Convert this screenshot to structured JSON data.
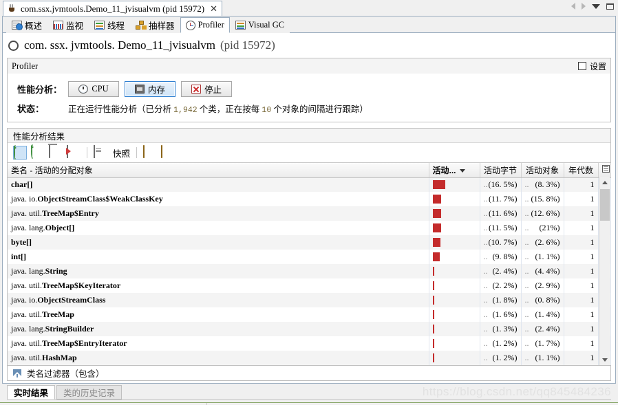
{
  "window": {
    "tab_title": "com.ssx.jvmtools.Demo_11_jvisualvm (pid 15972)",
    "close_label": "✕",
    "icon": "java-coffee-icon"
  },
  "view_tabs": [
    {
      "label": "概述",
      "icon": "overview-icon",
      "active": false
    },
    {
      "label": "监视",
      "icon": "monitor-icon",
      "active": false
    },
    {
      "label": "线程",
      "icon": "threads-icon",
      "active": false
    },
    {
      "label": "抽样器",
      "icon": "sampler-icon",
      "active": false
    },
    {
      "label": "Profiler",
      "icon": "profiler-icon",
      "active": true
    },
    {
      "label": "Visual GC",
      "icon": "visual-gc-icon",
      "active": false
    }
  ],
  "app_header": {
    "name": "com. ssx. jvmtools. Demo_11_jvisualvm",
    "pid": "(pid 15972)"
  },
  "subbar": {
    "title": "Profiler",
    "settings_label": "设置",
    "settings_checked": false
  },
  "profiling": {
    "row_label": "性能分析：",
    "buttons": [
      {
        "label": "CPU",
        "icon": "cpu-icon",
        "selected": false
      },
      {
        "label": "内存",
        "icon": "memory-icon",
        "selected": true
      },
      {
        "label": "停止",
        "icon": "stop-icon",
        "selected": false
      }
    ],
    "status_label": "状态：",
    "status_prefix": "正在运行性能分析（已分析 ",
    "status_classes": "1,942",
    "status_middle": " 个类，正在按每 ",
    "status_interval": "10",
    "status_suffix": " 个对象的间隔进行跟踪）"
  },
  "results": {
    "header": "性能分析结果",
    "toolbar": [
      {
        "name": "refresh-results-icon",
        "label": ""
      },
      {
        "name": "auto-refresh-icon",
        "label": ""
      },
      {
        "name": "reset-collected-results-icon",
        "label": ""
      },
      {
        "name": "export-icon",
        "label": ""
      },
      {
        "name": "snapshot-icon",
        "label": "快照"
      },
      {
        "name": "load-snapshot-icon",
        "label": ""
      },
      {
        "name": "save-snapshot-icon",
        "label": ""
      }
    ],
    "columns": [
      "类名 - 活动的分配对象",
      "活动...",
      "活动字节",
      "活动对象",
      "年代数"
    ],
    "sorted_column_index": 1,
    "rows": [
      {
        "pkg": "",
        "cls": "char[]",
        "bar_pct": 16.5,
        "bytes_pct": "(16. 5%)",
        "objects_pct": "(8. 3%)",
        "generations": "1"
      },
      {
        "pkg": "java. io.",
        "cls": "ObjectStreamClass$WeakClassKey",
        "bar_pct": 11.7,
        "bytes_pct": "(11. 7%)",
        "objects_pct": "(15. 8%)",
        "generations": "1"
      },
      {
        "pkg": "java. util.",
        "cls": "TreeMap$Entry",
        "bar_pct": 11.6,
        "bytes_pct": "(11. 6%)",
        "objects_pct": "(12. 6%)",
        "generations": "1"
      },
      {
        "pkg": "java. lang.",
        "cls": "Object[]",
        "bar_pct": 11.5,
        "bytes_pct": "(11. 5%)",
        "objects_pct": "(21%)",
        "generations": "1"
      },
      {
        "pkg": "",
        "cls": "byte[]",
        "bar_pct": 10.7,
        "bytes_pct": "(10. 7%)",
        "objects_pct": "(2. 6%)",
        "generations": "1"
      },
      {
        "pkg": "",
        "cls": "int[]",
        "bar_pct": 9.8,
        "bytes_pct": "(9. 8%)",
        "objects_pct": "(1. 1%)",
        "generations": "1"
      },
      {
        "pkg": "java. lang.",
        "cls": "String",
        "bar_pct": 2.4,
        "bytes_pct": "(2. 4%)",
        "objects_pct": "(4. 4%)",
        "generations": "1"
      },
      {
        "pkg": "java. util.",
        "cls": "TreeMap$KeyIterator",
        "bar_pct": 2.2,
        "bytes_pct": "(2. 2%)",
        "objects_pct": "(2. 9%)",
        "generations": "1"
      },
      {
        "pkg": "java. io.",
        "cls": "ObjectStreamClass",
        "bar_pct": 1.8,
        "bytes_pct": "(1. 8%)",
        "objects_pct": "(0. 8%)",
        "generations": "1"
      },
      {
        "pkg": "java. util.",
        "cls": "TreeMap",
        "bar_pct": 1.6,
        "bytes_pct": "(1. 6%)",
        "objects_pct": "(1. 4%)",
        "generations": "1"
      },
      {
        "pkg": "java. lang.",
        "cls": "StringBuilder",
        "bar_pct": 1.3,
        "bytes_pct": "(1. 3%)",
        "objects_pct": "(2. 4%)",
        "generations": "1"
      },
      {
        "pkg": "java. util.",
        "cls": "TreeMap$EntryIterator",
        "bar_pct": 1.2,
        "bytes_pct": "(1. 2%)",
        "objects_pct": "(1. 7%)",
        "generations": "1"
      },
      {
        "pkg": "java. util.",
        "cls": "HashMap",
        "bar_pct": 1.2,
        "bytes_pct": "(1. 2%)",
        "objects_pct": "(1. 1%)",
        "generations": "1"
      }
    ],
    "truncation_dots": ".."
  },
  "filter": {
    "placeholder": "类名过滤器（包含）",
    "icon": "filter-funnel-icon"
  },
  "bottom_tabs": [
    {
      "label": "实时结果",
      "active": true
    },
    {
      "label": "类的历史记录",
      "active": false
    }
  ],
  "watermark": "https://blog.csdn.net/qq845484236",
  "colors": {
    "bar": "#c42b2b",
    "accent": "#2f7fd0",
    "header_bg": "#f0f0f0"
  }
}
